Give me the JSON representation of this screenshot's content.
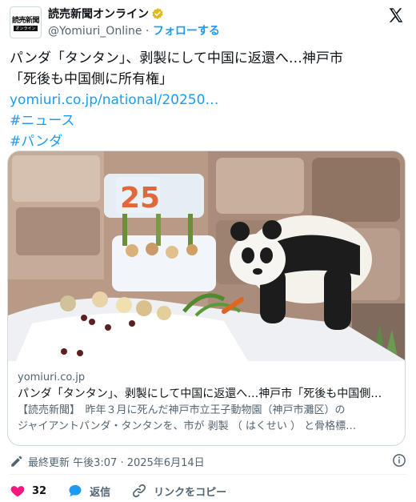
{
  "account": {
    "name": "読売新聞オンライン",
    "handle": "@Yomiuri_Online",
    "separator": "·",
    "follow_label": "フォローする",
    "logo_text": "読売新聞",
    "logo_sub": "オンライン"
  },
  "tweet": {
    "text_line1": "パンダ「タンタン」、剥製にして中国に返還へ…神戸市",
    "text_line2": "「死後も中国側に所有権」",
    "link": "yomiuri.co.jp/national/20250…",
    "hashtags": [
      "#ニュース",
      "#パンダ"
    ]
  },
  "card": {
    "sign_text": "25",
    "domain": "yomiuri.co.jp",
    "title": "パンダ「タンタン」、剥製にして中国に返還へ…神戸市「死後も中国側…",
    "desc_line1": "【読売新聞】　昨年３月に死んだ神戸市立王子動物園（神戸市灘区）の",
    "desc_line2": "ジャイアントパンダ・タンタンを、市が 剥製 （ はくせい ） と骨格標…"
  },
  "meta": {
    "timestamp": "最終更新 午後3:07 · 2025年6月14日"
  },
  "actions": {
    "like_count": "32",
    "reply_label": "返信",
    "copy_link_label": "リンクをコピー"
  },
  "colors": {
    "accent": "#1d9bf0",
    "like": "#f91880",
    "verified_gold": "#e2b719",
    "text": "#0f1419",
    "secondary": "#536471"
  },
  "icons": [
    "verified-badge-icon",
    "x-logo-icon",
    "edit-clock-icon",
    "info-icon",
    "heart-icon",
    "reply-icon",
    "link-icon"
  ]
}
